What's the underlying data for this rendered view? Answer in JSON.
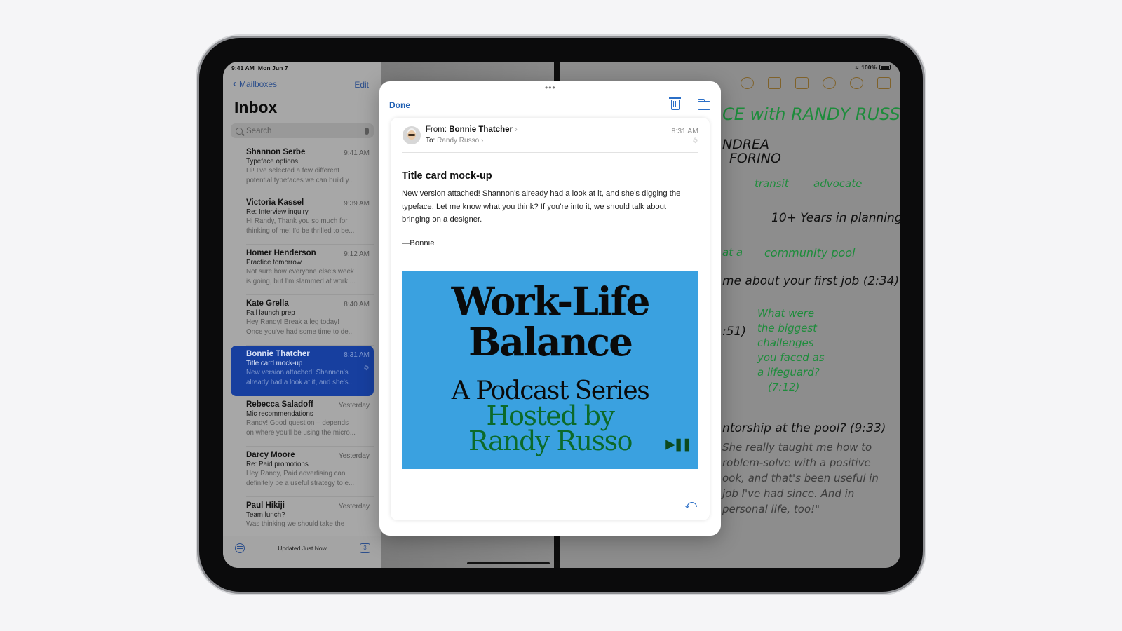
{
  "status_bar": {
    "time": "9:41 AM",
    "date": "Mon Jun 7",
    "battery": "100%"
  },
  "mail": {
    "back_label": "Mailboxes",
    "edit_label": "Edit",
    "title": "Inbox",
    "search_placeholder": "Search",
    "footer_status": "Updated Just Now",
    "drafts_count": "3",
    "messages": [
      {
        "from": "Shannon Serbe",
        "time": "9:41 AM",
        "subject": "Typeface options",
        "preview1": "Hi! I've selected a few different",
        "preview2": "potential typefaces we can build y..."
      },
      {
        "from": "Victoria Kassel",
        "time": "9:39 AM",
        "subject": "Re: Interview inquiry",
        "preview1": "Hi Randy, Thank you so much for",
        "preview2": "thinking of me! I'd be thrilled to be..."
      },
      {
        "from": "Homer Henderson",
        "time": "9:12 AM",
        "subject": "Practice tomorrow",
        "preview1": "Not sure how everyone else's week",
        "preview2": "is going, but I'm slammed at work!..."
      },
      {
        "from": "Kate Grella",
        "time": "8:40 AM",
        "subject": "Fall launch prep",
        "preview1": "Hey Randy! Break a leg today!",
        "preview2": "Once you've had some time to de..."
      },
      {
        "from": "Bonnie Thatcher",
        "time": "8:31 AM",
        "subject": "Title card mock-up",
        "preview1": "New version attached! Shannon's",
        "preview2": "already had a look at it, and she's...",
        "selected": true,
        "has_attachment": true
      },
      {
        "from": "Rebecca Saladoff",
        "time": "Yesterday",
        "subject": "Mic recommendations",
        "preview1": "Randy! Good question – depends",
        "preview2": "on where you'll be using the micro..."
      },
      {
        "from": "Darcy Moore",
        "time": "Yesterday",
        "subject": "Re: Paid promotions",
        "preview1": "Hey Randy, Paid advertising can",
        "preview2": "definitely be a useful strategy to e..."
      },
      {
        "from": "Paul Hikiji",
        "time": "Yesterday",
        "subject": "Team lunch?",
        "preview1": "Was thinking we should take the",
        "preview2": ""
      }
    ]
  },
  "modal": {
    "done_label": "Done",
    "from_label": "From:",
    "from_name": "Bonnie Thatcher",
    "to_label": "To:",
    "to_name": "Randy Russo",
    "time": "8:31 AM",
    "subject": "Title card mock-up",
    "body": "New version attached! Shannon's already had a look at it, and she's digging the typeface. Let me know what you think? If you're into it, we should talk about bringing on a designer.",
    "signature": "—Bonnie",
    "attachment": {
      "title_line1": "Work-Life",
      "title_line2": "Balance",
      "subtitle": "A Podcast Series",
      "hosted_line1": "Hosted by",
      "hosted_line2": "Randy Russo",
      "play_glyph": "▶❚❚"
    }
  },
  "notes": {
    "sketch": [
      {
        "text": "CE with RANDY RUSSO",
        "color": "g"
      },
      {
        "text": "NDREA",
        "color": "k"
      },
      {
        "text": "FORINO",
        "color": "k"
      },
      {
        "text": "transit",
        "color": "g"
      },
      {
        "text": "advocate",
        "color": "g"
      },
      {
        "text": "10+ Years in planning",
        "color": "k"
      },
      {
        "text": "at a",
        "color": "g"
      },
      {
        "text": "community pool",
        "color": "g"
      },
      {
        "text": "me about your first job (2:34)",
        "color": "k"
      },
      {
        "text": ":51)",
        "color": "k"
      },
      {
        "text": "What were",
        "color": "g"
      },
      {
        "text": "the biggest",
        "color": "g"
      },
      {
        "text": "challenges",
        "color": "g"
      },
      {
        "text": "you faced as",
        "color": "g"
      },
      {
        "text": "a lifeguard?",
        "color": "g"
      },
      {
        "text": "(7:12)",
        "color": "g"
      },
      {
        "text": "ntorship at the pool? (9:33)",
        "color": "k"
      },
      {
        "text": "She really taught me how to",
        "color": "q"
      },
      {
        "text": "roblem-solve with a positive",
        "color": "q"
      },
      {
        "text": "ook, and that's been useful in",
        "color": "q"
      },
      {
        "text": "job I've had since. And in",
        "color": "q"
      },
      {
        "text": "personal life, too!\"",
        "color": "q"
      }
    ]
  }
}
